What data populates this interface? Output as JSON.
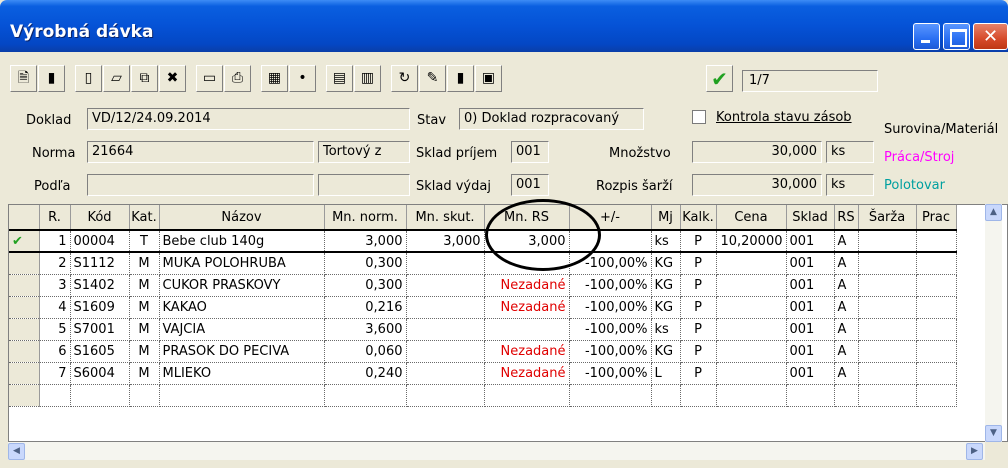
{
  "window": {
    "title": "Výrobná dávka"
  },
  "toolbar": {
    "icons": [
      "new-doc",
      "save",
      "blank",
      "open",
      "copy",
      "delete",
      "monitor",
      "print",
      "table",
      "dot",
      "sheet1",
      "sheet2",
      "refresh",
      "edit",
      "save2",
      "layers"
    ],
    "record_counter": "1/7"
  },
  "form": {
    "doklad_label": "Doklad",
    "doklad_value": "VD/12/24.09.2014",
    "stav_label": "Stav",
    "stav_value": "0) Doklad rozpracovaný",
    "kontrola_label": "Kontrola stavu zásob",
    "norma_label": "Norma",
    "norma_value": "21664",
    "norma_name": "Tortový z",
    "sklad_prijem_label": "Sklad príjem",
    "sklad_prijem_value": "001",
    "mnozstvo_label": "Množstvo",
    "mnozstvo_value": "30,000",
    "mnozstvo_unit": "ks",
    "podla_label": "Podľa",
    "sklad_vydaj_label": "Sklad výdaj",
    "sklad_vydaj_value": "001",
    "rozpis_label": "Rozpis šarží",
    "rozpis_value": "30,000",
    "rozpis_unit": "ks"
  },
  "legend": {
    "item1": "Surovina/Materiál",
    "item2": "Práca/Stroj",
    "item3": "Polotovar",
    "color2": "#ff00ff",
    "color3": "#00a0a0"
  },
  "table": {
    "columns": [
      "R.",
      "Kód",
      "Kat.",
      "Názov",
      "Mn. norm.",
      "Mn. skut.",
      "Mn. RS",
      "+/-",
      "Mj",
      "Kalk.",
      "Cena",
      "Sklad",
      "RS",
      "Šarža",
      "Prac"
    ],
    "rows": [
      {
        "r": "1",
        "kod": "00004",
        "kat": "T",
        "nazov": "Bebe club 140g",
        "mn_norm": "3,000",
        "mn_skut": "3,000",
        "mn_rs": "3,000",
        "pm": "",
        "mj": "ks",
        "kalk": "P",
        "cena": "10,20000",
        "sklad": "001",
        "rs": "A",
        "current": true
      },
      {
        "r": "2",
        "kod": "S1112",
        "kat": "M",
        "nazov": "MUKA POLOHRUBA",
        "mn_norm": "0,300",
        "mn_skut": "",
        "mn_rs": "",
        "pm": "-100,00%",
        "mj": "KG",
        "kalk": "P",
        "cena": "",
        "sklad": "001",
        "rs": "A"
      },
      {
        "r": "3",
        "kod": "S1402",
        "kat": "M",
        "nazov": "CUKOR PRASKOVY",
        "mn_norm": "0,300",
        "mn_skut": "",
        "mn_rs": "Nezadané",
        "pm": "-100,00%",
        "mj": "KG",
        "kalk": "P",
        "cena": "",
        "sklad": "001",
        "rs": "A"
      },
      {
        "r": "4",
        "kod": "S1609",
        "kat": "M",
        "nazov": "KAKAO",
        "mn_norm": "0,216",
        "mn_skut": "",
        "mn_rs": "Nezadané",
        "pm": "-100,00%",
        "mj": "KG",
        "kalk": "P",
        "cena": "",
        "sklad": "001",
        "rs": "A"
      },
      {
        "r": "5",
        "kod": "S7001",
        "kat": "M",
        "nazov": "VAJCIA",
        "mn_norm": "3,600",
        "mn_skut": "",
        "mn_rs": "",
        "pm": "-100,00%",
        "mj": "ks",
        "kalk": "P",
        "cena": "",
        "sklad": "001",
        "rs": "A"
      },
      {
        "r": "6",
        "kod": "S1605",
        "kat": "M",
        "nazov": "PRASOK DO PECIVA",
        "mn_norm": "0,060",
        "mn_skut": "",
        "mn_rs": "Nezadané",
        "pm": "-100,00%",
        "mj": "KG",
        "kalk": "P",
        "cena": "",
        "sklad": "001",
        "rs": "A"
      },
      {
        "r": "7",
        "kod": "S6004",
        "kat": "M",
        "nazov": "MLIEKO",
        "mn_norm": "0,240",
        "mn_skut": "",
        "mn_rs": "Nezadané",
        "pm": "-100,00%",
        "mj": "L",
        "kalk": "P",
        "cena": "",
        "sklad": "001",
        "rs": "A"
      }
    ]
  }
}
